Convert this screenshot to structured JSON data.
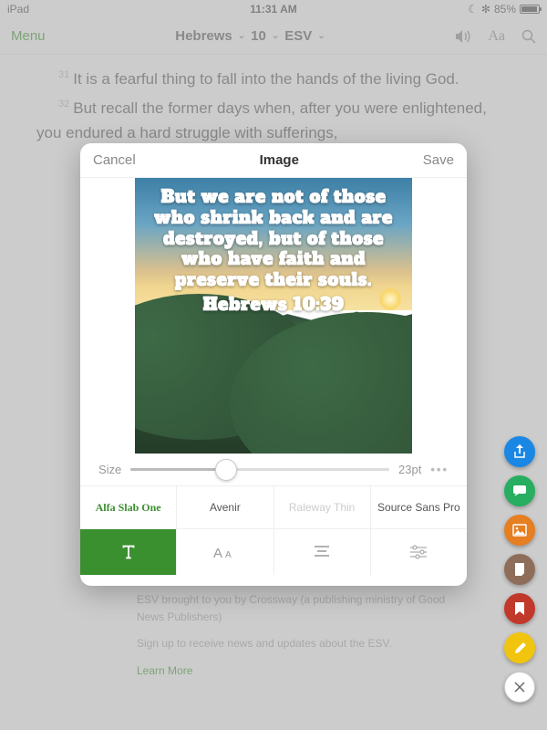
{
  "statusbar": {
    "carrier": "iPad",
    "time": "11:31 AM",
    "battery": "85%",
    "bt": "✻"
  },
  "navbar": {
    "menu": "Menu",
    "book": "Hebrews",
    "chapter": "10",
    "translation": "ESV"
  },
  "verses": {
    "v31_num": "31",
    "v31": "It is a fearful thing to fall into the hands of the living God.",
    "v32_num": "32",
    "v32": "But recall the former days when, after you were enlightened, you endured a hard struggle with sufferings,"
  },
  "modal": {
    "cancel": "Cancel",
    "title": "Image",
    "save": "Save",
    "verse_text": "But we are not of those who shrink back and are destroyed, but of those who have faith and preserve their souls.",
    "reference": "Hebrews 10:39",
    "size_label": "Size",
    "size_value": "23pt",
    "fonts": [
      "Alfa Slab One",
      "Avenir",
      "Raleway Thin",
      "Source Sans Pro"
    ],
    "selected_font_index": 0
  },
  "footer": {
    "line1": "ESV brought to you by Crossway (a publishing ministry of Good News Publishers)",
    "line2": "Sign up to receive news and updates about the ESV.",
    "learn": "Learn More"
  },
  "colors": {
    "accent": "#3a8f2f"
  }
}
